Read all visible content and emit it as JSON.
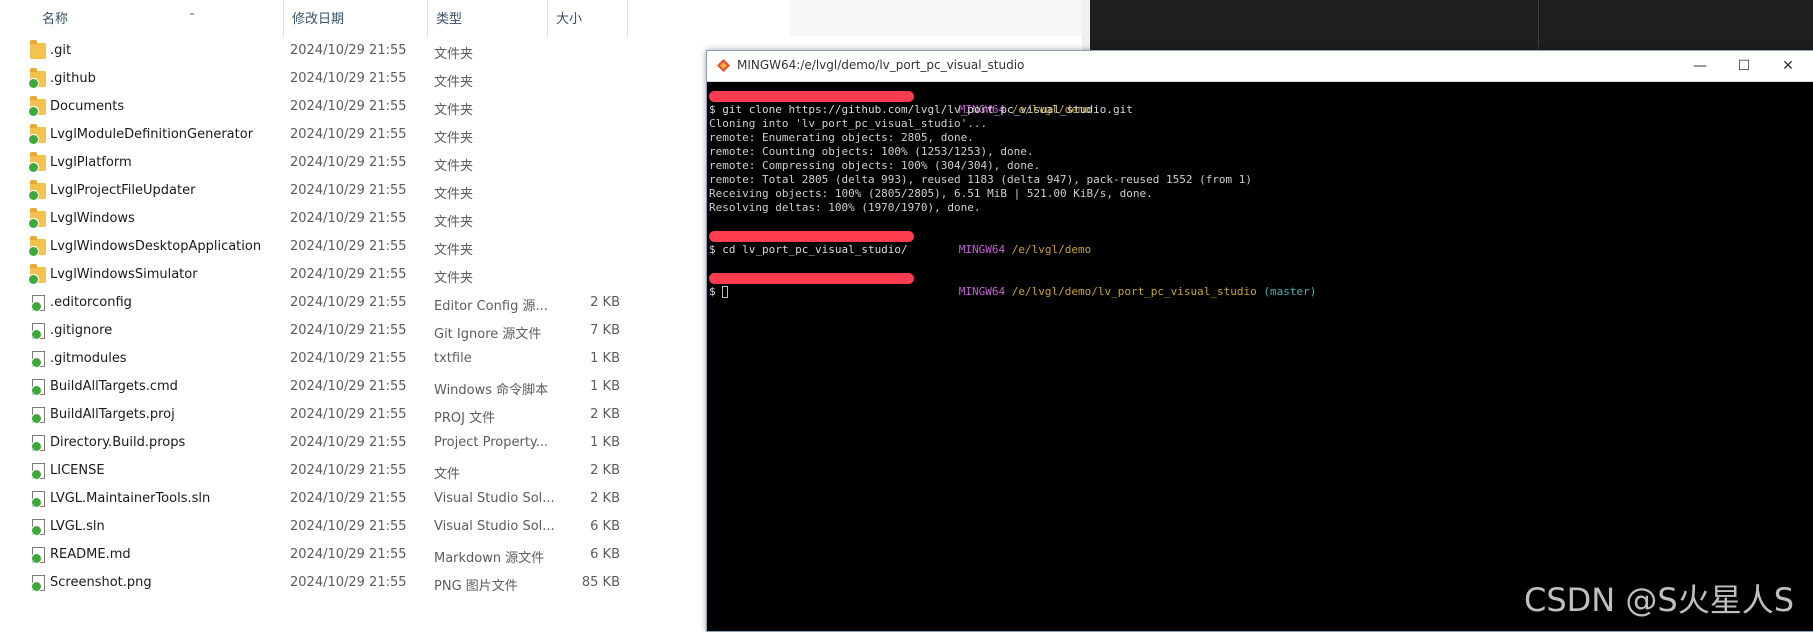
{
  "explorer": {
    "columns": {
      "name": "名称",
      "date": "修改日期",
      "type": "类型",
      "size": "大小"
    },
    "items": [
      {
        "name": ".git",
        "date": "2024/10/29 21:55",
        "type": "文件夹",
        "size": "",
        "icon": "folder-icon"
      },
      {
        "name": ".github",
        "date": "2024/10/29 21:55",
        "type": "文件夹",
        "size": "",
        "icon": "folder-icon"
      },
      {
        "name": "Documents",
        "date": "2024/10/29 21:55",
        "type": "文件夹",
        "size": "",
        "icon": "folder-icon"
      },
      {
        "name": "LvglModuleDefinitionGenerator",
        "date": "2024/10/29 21:55",
        "type": "文件夹",
        "size": "",
        "icon": "folder-icon"
      },
      {
        "name": "LvglPlatform",
        "date": "2024/10/29 21:55",
        "type": "文件夹",
        "size": "",
        "icon": "folder-icon"
      },
      {
        "name": "LvglProjectFileUpdater",
        "date": "2024/10/29 21:55",
        "type": "文件夹",
        "size": "",
        "icon": "folder-icon"
      },
      {
        "name": "LvglWindows",
        "date": "2024/10/29 21:55",
        "type": "文件夹",
        "size": "",
        "icon": "folder-icon"
      },
      {
        "name": "LvglWindowsDesktopApplication",
        "date": "2024/10/29 21:55",
        "type": "文件夹",
        "size": "",
        "icon": "folder-icon"
      },
      {
        "name": "LvglWindowsSimulator",
        "date": "2024/10/29 21:55",
        "type": "文件夹",
        "size": "",
        "icon": "folder-icon"
      },
      {
        "name": ".editorconfig",
        "date": "2024/10/29 21:55",
        "type": "Editor Config 源...",
        "size": "2 KB",
        "icon": "file-icon"
      },
      {
        "name": ".gitignore",
        "date": "2024/10/29 21:55",
        "type": "Git Ignore 源文件",
        "size": "7 KB",
        "icon": "file-icon"
      },
      {
        "name": ".gitmodules",
        "date": "2024/10/29 21:55",
        "type": "txtfile",
        "size": "1 KB",
        "icon": "file-icon"
      },
      {
        "name": "BuildAllTargets.cmd",
        "date": "2024/10/29 21:55",
        "type": "Windows 命令脚本",
        "size": "1 KB",
        "icon": "file-icon"
      },
      {
        "name": "BuildAllTargets.proj",
        "date": "2024/10/29 21:55",
        "type": "PROJ 文件",
        "size": "2 KB",
        "icon": "file-icon"
      },
      {
        "name": "Directory.Build.props",
        "date": "2024/10/29 21:55",
        "type": "Project Property...",
        "size": "1 KB",
        "icon": "file-icon"
      },
      {
        "name": "LICENSE",
        "date": "2024/10/29 21:55",
        "type": "文件",
        "size": "2 KB",
        "icon": "file-icon"
      },
      {
        "name": "LVGL.MaintainerTools.sln",
        "date": "2024/10/29 21:55",
        "type": "Visual Studio Sol...",
        "size": "2 KB",
        "icon": "file-icon"
      },
      {
        "name": "LVGL.sln",
        "date": "2024/10/29 21:55",
        "type": "Visual Studio Sol...",
        "size": "6 KB",
        "icon": "file-icon"
      },
      {
        "name": "README.md",
        "date": "2024/10/29 21:55",
        "type": "Markdown 源文件",
        "size": "6 KB",
        "icon": "file-icon"
      },
      {
        "name": "Screenshot.png",
        "date": "2024/10/29 21:55",
        "type": "PNG 图片文件",
        "size": "85 KB",
        "icon": "file-icon"
      }
    ]
  },
  "terminal": {
    "title": "MINGW64:/e/lvgl/demo/lv_port_pc_visual_studio",
    "controls": {
      "minimize": "—",
      "maximize": "☐",
      "close": "✕"
    },
    "prompt1": {
      "env": "MINGW64",
      "path": "/e/lvgl/demo"
    },
    "cmd1": "$ git clone https://github.com/lvgl/lv_port_pc_visual_studio.git",
    "output": [
      "Cloning into 'lv_port_pc_visual_studio'...",
      "remote: Enumerating objects: 2805, done.",
      "remote: Counting objects: 100% (1253/1253), done.",
      "remote: Compressing objects: 100% (304/304), done.",
      "remote: Total 2805 (delta 993), reused 1183 (delta 947), pack-reused 1552 (from 1)",
      "Receiving objects: 100% (2805/2805), 6.51 MiB | 521.00 KiB/s, done.",
      "Resolving deltas: 100% (1970/1970), done."
    ],
    "prompt2": {
      "env": "MINGW64",
      "path": "/e/lvgl/demo"
    },
    "cmd2": "$ cd lv_port_pc_visual_studio/",
    "prompt3": {
      "env": "MINGW64",
      "path": "/e/lvgl/demo/lv_port_pc_visual_studio",
      "branch": "(master)"
    },
    "cmd3": "$ "
  },
  "watermark": "CSDN @S火星人S",
  "colors": {
    "accent_green": "#37b84c",
    "accent_magenta": "#c462d6",
    "accent_yellow": "#c9a227",
    "accent_cyan": "#3fb3b5",
    "redaction": "#ff3b4f"
  }
}
